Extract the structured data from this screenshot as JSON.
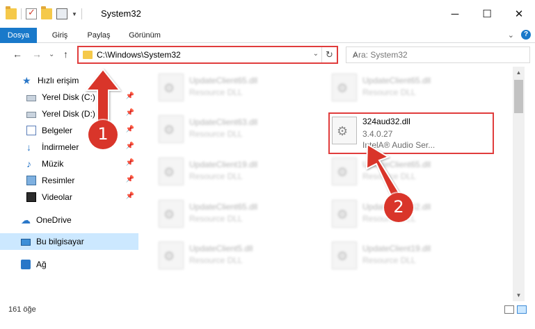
{
  "window": {
    "title": "System32",
    "controls": {
      "minimize": "─",
      "maximize": "☐",
      "close": "✕"
    }
  },
  "ribbon": {
    "tabs": [
      "Dosya",
      "Giriş",
      "Paylaş",
      "Görünüm"
    ],
    "help": "?",
    "expand": "⌄"
  },
  "nav": {
    "back": "←",
    "forward": "→",
    "recent": "⌄",
    "up": "↑",
    "address": "C:\\Windows\\System32",
    "address_dropdown": "⌄",
    "refresh": "↻",
    "search_placeholder": "Ara: System32",
    "search_icon": "⌕"
  },
  "sidebar": {
    "items": [
      {
        "label": "Hızlı erişim",
        "icon": "star-icon",
        "pinned": false
      },
      {
        "label": "Yerel Disk (C:)",
        "icon": "disk-icon",
        "pinned": true
      },
      {
        "label": "Yerel Disk (D:)",
        "icon": "disk-icon",
        "pinned": true
      },
      {
        "label": "Belgeler",
        "icon": "document-icon",
        "pinned": true
      },
      {
        "label": "İndirmeler",
        "icon": "download-icon",
        "pinned": true
      },
      {
        "label": "Müzik",
        "icon": "music-icon",
        "pinned": true
      },
      {
        "label": "Resimler",
        "icon": "pictures-icon",
        "pinned": true
      },
      {
        "label": "Videolar",
        "icon": "video-icon",
        "pinned": true
      },
      {
        "label": "OneDrive",
        "icon": "cloud-icon",
        "pinned": false
      },
      {
        "label": "Bu bilgisayar",
        "icon": "computer-icon",
        "pinned": false
      },
      {
        "label": "Ağ",
        "icon": "network-icon",
        "pinned": false
      }
    ],
    "pin_glyph": "📌"
  },
  "files": {
    "left": [
      {
        "name": "UpdateClient65.dll",
        "desc": "Resource DLL"
      },
      {
        "name": "UpdateClient63.dll",
        "desc": "Resource DLL"
      },
      {
        "name": "UpdateClient19.dll",
        "desc": "Resource DLL"
      },
      {
        "name": "UpdateClient65.dll",
        "desc": "Resource DLL"
      },
      {
        "name": "UpdateClient5.dll",
        "desc": "Resource DLL"
      }
    ],
    "right": [
      {
        "name": "UpdateClient65.dll",
        "desc": "Resource DLL"
      },
      {
        "name": "UpdateClient65.dll",
        "desc": "Resource DLL"
      },
      {
        "name": "UpdateClient42.dll",
        "desc": "Resource DLL"
      },
      {
        "name": "UpdateClient19.dll",
        "desc": "Resource DLL"
      }
    ],
    "highlighted": {
      "name": "324aud32.dll",
      "version": "3.4.0.27",
      "desc": "IntelA® Audio Ser..."
    }
  },
  "annotations": {
    "step1": "1",
    "step2": "2",
    "color": "#d9352a"
  },
  "status": {
    "count": "161 öğe"
  },
  "colors": {
    "accent": "#1979ca",
    "highlight": "#e03c3c",
    "selection": "#cce8ff"
  }
}
